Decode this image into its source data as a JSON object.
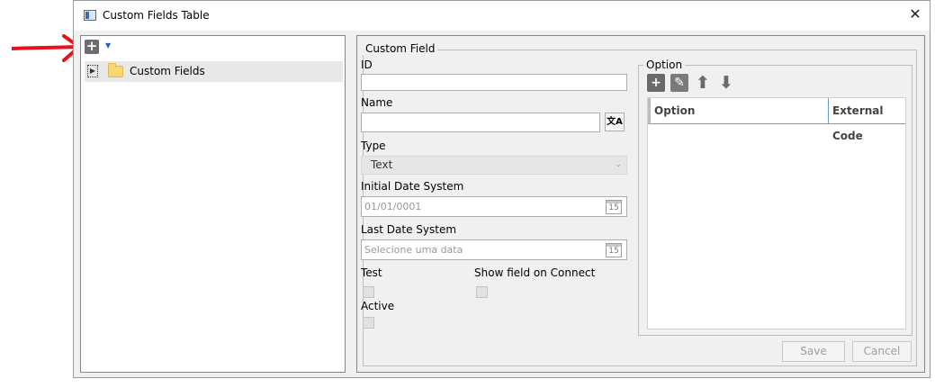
{
  "window": {
    "title": "Custom Fields Table"
  },
  "tree": {
    "items": [
      {
        "label": "Custom Fields"
      }
    ]
  },
  "form": {
    "group_title": "Custom Field",
    "id_label": "ID",
    "id_value": "",
    "name_label": "Name",
    "name_value": "",
    "type_label": "Type",
    "type_value": "Text",
    "initial_date_label": "Initial Date System",
    "initial_date_value": "01/01/0001",
    "last_date_label": "Last Date System",
    "last_date_placeholder": "Selecione uma data",
    "test_label": "Test",
    "show_field_label": "Show field on Connect",
    "active_label": "Active",
    "calendar_day": "15"
  },
  "options": {
    "group_title": "Option",
    "columns": [
      "Option",
      "External Code"
    ],
    "rows": []
  },
  "buttons": {
    "save": "Save",
    "cancel": "Cancel"
  },
  "colors": {
    "annotation_arrow": "#e8121a",
    "grid_header_line": "#6a9bd0"
  }
}
